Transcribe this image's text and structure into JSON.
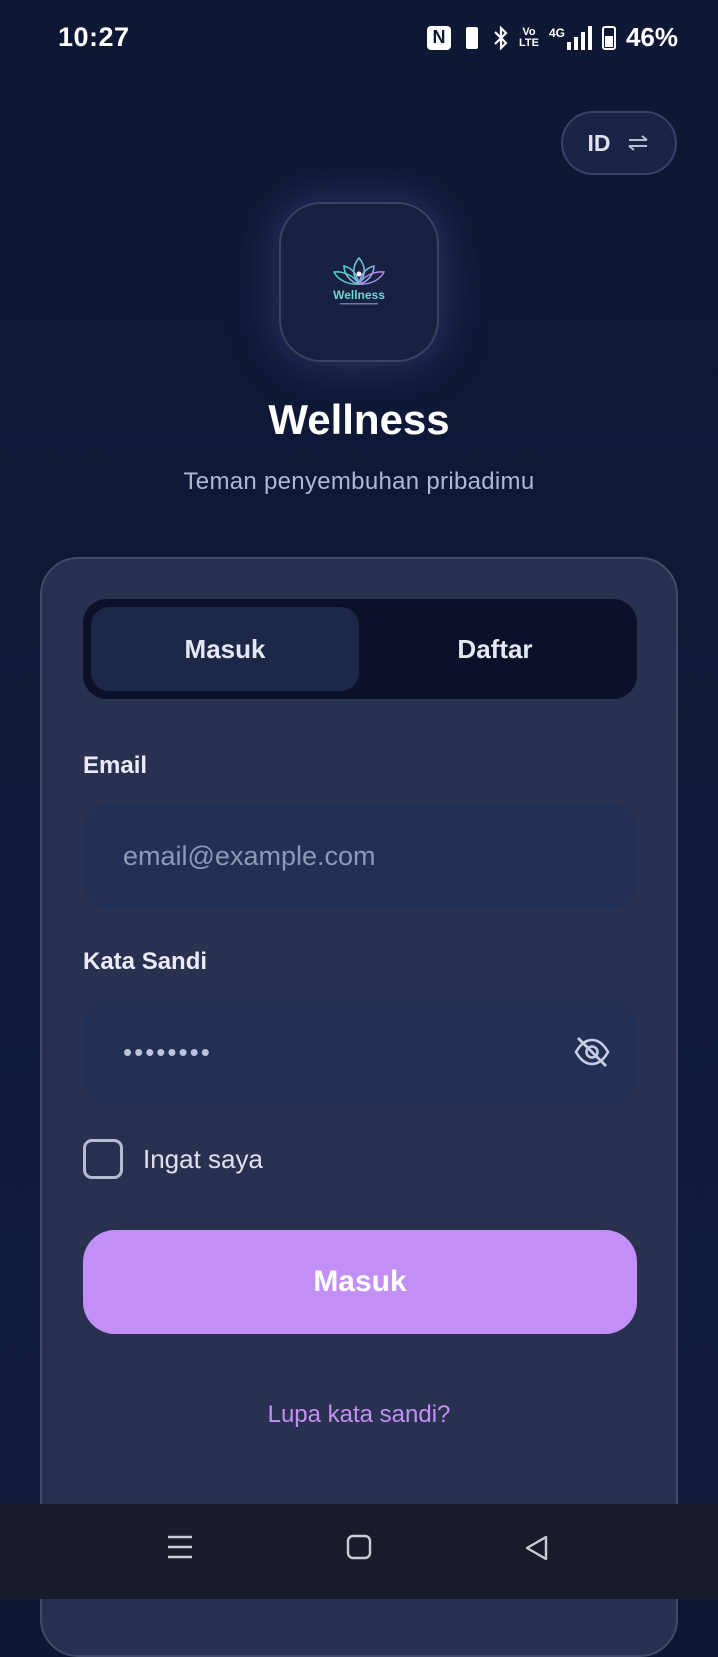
{
  "status_bar": {
    "time": "10:27",
    "battery": "46%",
    "nfc": "N",
    "volte_top": "Vo",
    "volte_bottom": "LTE",
    "network": "4G",
    "icons": [
      "nfc-icon",
      "vibrate-icon",
      "bluetooth-icon",
      "volte-icon",
      "signal-4g-icon",
      "battery-icon"
    ]
  },
  "language_button": {
    "label": "ID",
    "icon": "swap-icon"
  },
  "app": {
    "logo_text": "Wellness",
    "title": "Wellness",
    "subtitle": "Teman penyembuhan pribadimu"
  },
  "tabs": {
    "login": "Masuk",
    "register": "Daftar",
    "active": "login"
  },
  "form": {
    "email_label": "Email",
    "email_placeholder": "email@example.com",
    "email_value": "",
    "password_label": "Kata Sandi",
    "password_value": "••••••••",
    "remember_label": "Ingat saya",
    "remember_checked": false,
    "submit_label": "Masuk",
    "forgot_link": "Lupa kata sandi?"
  },
  "colors": {
    "background": "#0e1733",
    "card": "#2a3150",
    "input": "#223056",
    "accent": "#c18ff6",
    "link": "#c190f3"
  },
  "nav_bar": {
    "icons": [
      "menu-icon",
      "home-icon",
      "back-icon"
    ]
  }
}
